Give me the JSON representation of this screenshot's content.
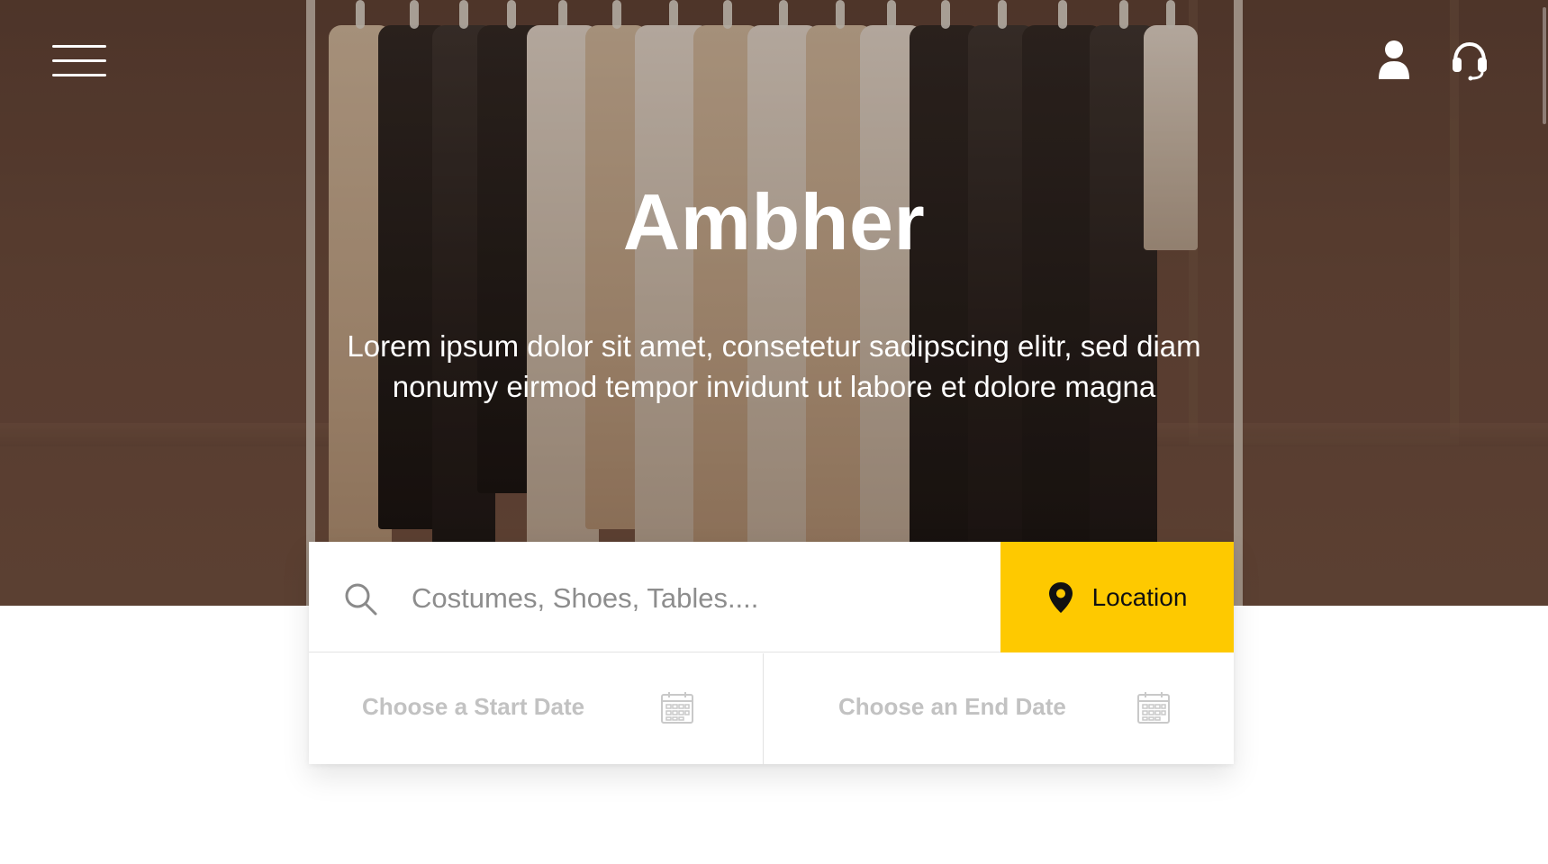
{
  "header": {
    "menu_icon": "hamburger-menu-icon",
    "account_icon": "user-icon",
    "support_icon": "headset-icon"
  },
  "hero": {
    "title": "Ambher",
    "tagline": "Lorem ipsum dolor sit amet, consetetur sadipscing elitr, sed diam nonumy eirmod tempor invidunt ut labore et dolore magna"
  },
  "search": {
    "placeholder": "Costumes, Shoes, Tables....",
    "value": "",
    "location_label": "Location"
  },
  "dates": {
    "start_label": "Choose a Start Date",
    "end_label": "Choose an End Date"
  },
  "colors": {
    "accent": "#fec900",
    "placeholder": "#8d8d8d",
    "date_label": "#c2c2c2"
  }
}
